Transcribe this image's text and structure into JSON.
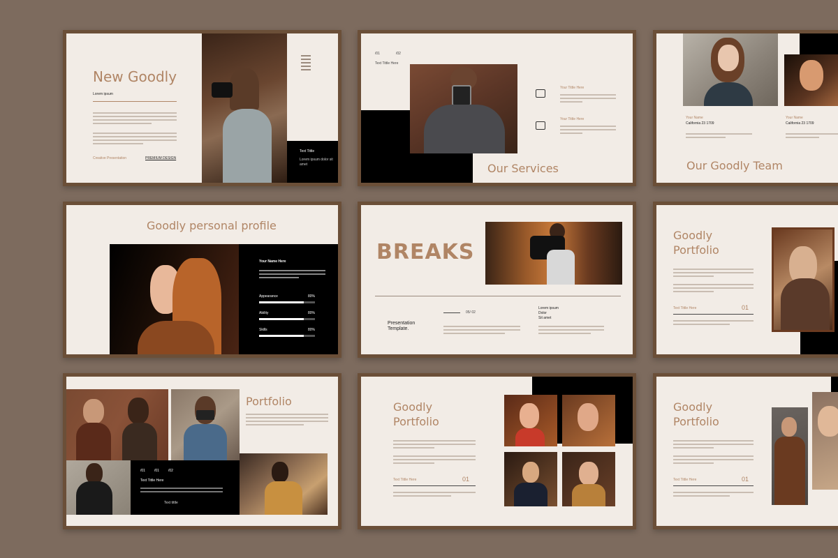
{
  "colors": {
    "background": "#7d6b5e",
    "slide": "#f2ece6",
    "frame": "#6b4f38",
    "accent": "#b08565",
    "dark": "#000000"
  },
  "slides": {
    "s1": {
      "title": "New Goodly",
      "subtitle": "Lorem ipsum",
      "footer_left": "Creative Presentation",
      "footer_right": "PREMIUM DESIGN",
      "box_title": "Text Tittle",
      "box_text": "Lorem ipsum dolor sit amet"
    },
    "s2": {
      "title": "Our Services",
      "label1": "/01",
      "label2": "/02",
      "small_title": "Text Tittle Here",
      "item1_title": "Your Tittle Here",
      "item2_title": "Your Tittle Here"
    },
    "s3": {
      "title": "Our Goodly Team",
      "name1": "Your Name",
      "name2": "Your Name",
      "role1": "California 23 1709",
      "role2": "California 23 1709"
    },
    "s4": {
      "title": "Goodly personal profile",
      "name": "Your Name Here",
      "skills": [
        {
          "label": "Appearance",
          "value": "80%",
          "level": 0.8
        },
        {
          "label": "Ability",
          "value": "80%",
          "level": 0.8
        },
        {
          "label": "Skills",
          "value": "80%",
          "level": 0.8
        }
      ]
    },
    "s5": {
      "title": "BREAKS",
      "caption": "Presentation Template.",
      "page": "05/ 02",
      "meta1": "Lorem ipsum",
      "meta2": "Dolor",
      "meta3": "Sit amet"
    },
    "s6": {
      "title1": "Goodly",
      "title2": "Portfolio",
      "text_title": "Text Tittle Here",
      "number": "01"
    },
    "s7": {
      "title": "Portfolio",
      "labels": [
        "/01",
        "/01",
        "/02"
      ],
      "text_title": "Text Tittle Here",
      "foot": "Text tittle"
    },
    "s8": {
      "title1": "Goodly",
      "title2": "Portfolio",
      "text_title": "Text Tittle Here",
      "number": "01"
    },
    "s9": {
      "title1": "Goodly",
      "title2": "Portfolio",
      "text_title": "Text Tittle Here",
      "number": "01"
    }
  }
}
